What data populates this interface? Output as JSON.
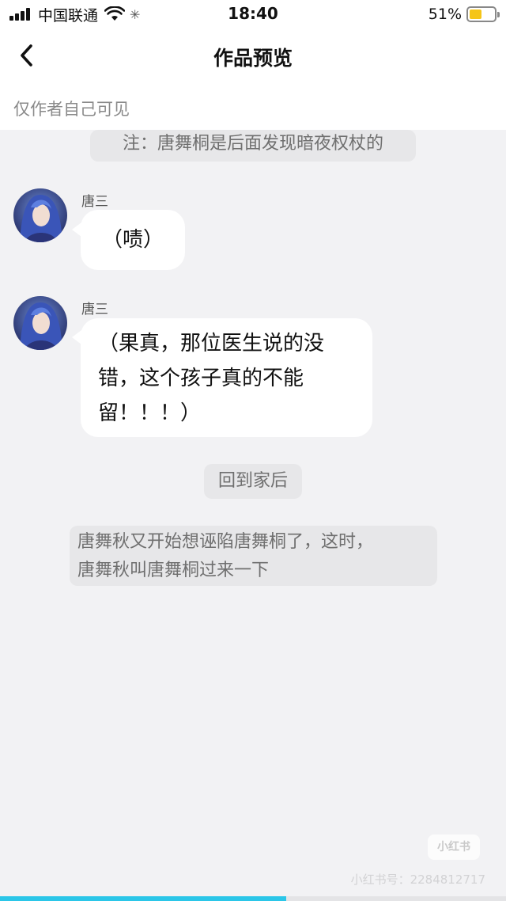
{
  "status_bar": {
    "carrier": "中国联通",
    "time": "18:40",
    "battery_percent": "51%",
    "battery_level": 0.51
  },
  "nav": {
    "back_icon": "chevron-left-icon",
    "title": "作品预览"
  },
  "notice": "仅作者自己可见",
  "messages": [
    {
      "type": "system",
      "text": "注：唐舞桐是后面发现暗夜权杖的"
    },
    {
      "type": "chat",
      "sender": "唐三",
      "lines": [
        "（啧）"
      ]
    },
    {
      "type": "chat",
      "sender": "唐三",
      "lines": [
        "（果真，那位医生说的没",
        "错，这个孩子真的不能",
        "留！！！）"
      ]
    },
    {
      "type": "system",
      "text": "回到家后"
    },
    {
      "type": "system",
      "lines": [
        "唐舞秋又开始想诬陷唐舞桐了，这时，",
        "唐舞秋叫唐舞桐过来一下"
      ]
    }
  ],
  "watermark": {
    "logo": "小红书",
    "text": "小红书号：2284812717"
  },
  "progress": 0.565,
  "colors": {
    "background": "#f2f2f4",
    "bubble": "#ffffff",
    "system_bubble": "#e7e7e9",
    "progress": "#2bc6e8",
    "battery": "#f5c518"
  }
}
